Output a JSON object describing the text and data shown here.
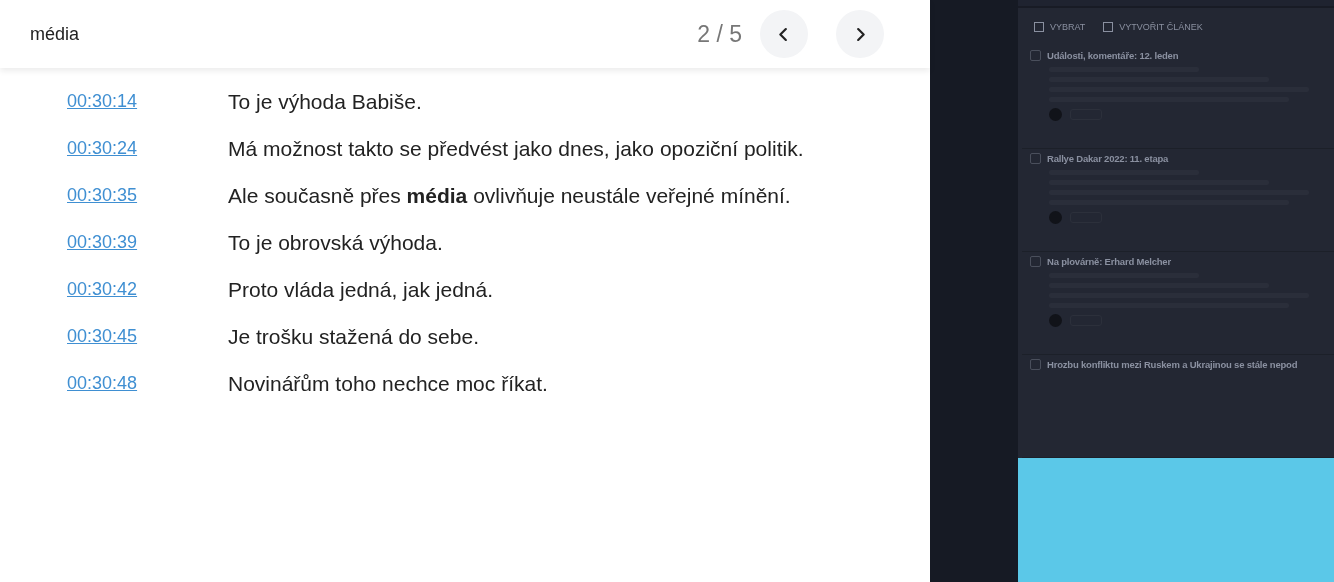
{
  "search_bar": {
    "query": "média",
    "counter": "2 / 5",
    "buttons": [
      {
        "kind": "prev"
      },
      {
        "kind": "next"
      }
    ]
  },
  "transcript": [
    {
      "time": "00:30:14",
      "text": "To je výhoda Babiše."
    },
    {
      "time": "00:30:24",
      "text": "Má možnost takto se předvést jako dnes, jako opoziční politik."
    },
    {
      "time": "00:30:35",
      "text": "Ale současně přes **média** ovlivňuje neustále veřejné mínění."
    },
    {
      "time": "00:30:39",
      "text": "To je obrovská výhoda."
    },
    {
      "time": "00:30:42",
      "text": "Proto vláda jedná, jak jedná."
    },
    {
      "time": "00:30:45",
      "text": "Je trošku stažená do sebe."
    },
    {
      "time": "00:30:48",
      "text": "Novinářům toho nechce moc říkat."
    }
  ],
  "background_app": {
    "toolbar": [
      "VYBRAT",
      "VYTVOŘIT ČLÁNEK"
    ],
    "articles": [
      {
        "title": "Události, komentáře: 12. leden",
        "checked": false
      },
      {
        "title": "Rallye Dakar 2022: 11. etapa",
        "checked": false
      },
      {
        "title": "Na plovárně: Erhard Melcher",
        "checked": false
      },
      {
        "title": "Hrozbu konfliktu mezi Ruskem a Ukrajinou se stále nepod",
        "checked": false
      }
    ]
  }
}
